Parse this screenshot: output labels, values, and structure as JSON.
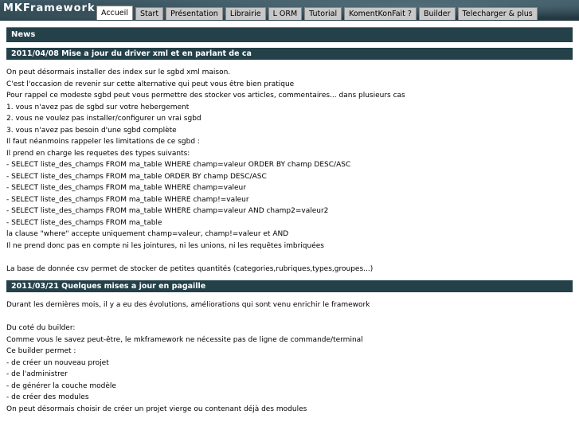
{
  "header": {
    "logo": "MKFramework",
    "tabs": [
      {
        "label": "Accueil",
        "active": true
      },
      {
        "label": "Start"
      },
      {
        "label": "Présentation"
      },
      {
        "label": "Librairie"
      },
      {
        "label": "L ORM"
      },
      {
        "label": "Tutorial"
      },
      {
        "label": "KomentKonFait ?"
      },
      {
        "label": "Builder"
      },
      {
        "label": "Telecharger & plus"
      }
    ]
  },
  "news": {
    "heading": "News",
    "articles": [
      {
        "title": "2011/04/08 Mise a jour du driver xml et en parlant de ca",
        "lines": [
          "On peut désormais installer des index sur le sgbd xml maison.",
          "C'est l'occasion de revenir sur cette alternative qui peut vous être bien pratique",
          "Pour rappel ce modeste sgbd peut vous permettre des stocker vos articles, commentaires... dans plusieurs cas",
          "1. vous n'avez pas de sgbd sur votre hebergement",
          "2. vous ne voulez pas installer/configurer un vrai sgbd",
          "3. vous n'avez pas besoin d'une sgbd complète",
          "Il faut néanmoins rappeler les limitations de ce sgbd :",
          "Il prend en charge les requetes des types suivants:",
          "- SELECT liste_des_champs FROM ma_table WHERE champ=valeur ORDER BY champ DESC/ASC",
          "- SELECT liste_des_champs FROM ma_table ORDER BY champ DESC/ASC",
          "- SELECT liste_des_champs FROM ma_table WHERE champ=valeur",
          "- SELECT liste_des_champs FROM ma_table WHERE champ!=valeur",
          "- SELECT liste_des_champs FROM ma_table WHERE champ=valeur AND champ2=valeur2",
          "- SELECT liste_des_champs FROM ma_table",
          "la clause \"where\" accepte uniquement champ=valeur, champ!=valeur et AND",
          "Il ne prend donc pas en compte ni les jointures, ni les unions, ni les requêtes imbriquées",
          "",
          "La base de donnée csv permet de stocker de petites quantités (categories,rubriques,types,groupes...)"
        ]
      },
      {
        "title": "2011/03/21 Quelques mises a jour en pagaille",
        "lines": [
          "Durant les dernières mois, il y a eu des évolutions, améliorations qui sont venu enrichir le framework",
          "",
          "Du coté du builder:",
          "Comme vous le savez peut-être, le mkframework ne nécessite pas de ligne de commande/terminal",
          "Ce builder permet :",
          "- de créer un nouveau projet",
          "- de l'administrer",
          "- de générer la couche modèle",
          "- de créer des modules",
          "On peut désormais choisir de créer un projet vierge ou contenant déjà des modules"
        ]
      }
    ]
  }
}
